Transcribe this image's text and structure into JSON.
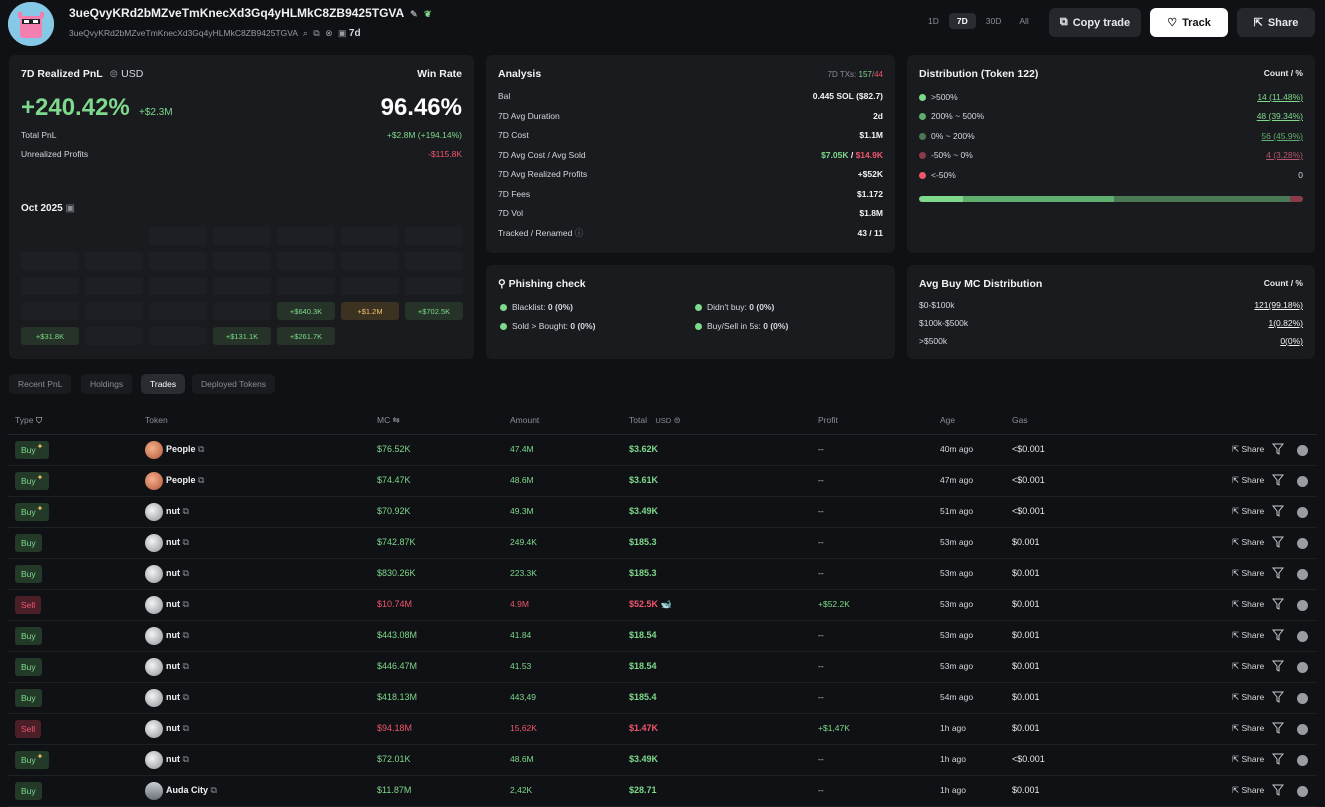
{
  "header": {
    "address": "3ueQvyKRd2bMZveTmKnecXd3Gq4yHLMkC8ZB9425TGVA",
    "address_sub": "3ueQvyKRd2bMZveTmKnecXd3Gq4yHLMkC8ZB9425TGVA",
    "age_label": "7d",
    "periods": [
      "1D",
      "7D",
      "30D",
      "All"
    ],
    "active_period": "7D",
    "copy_trade_label": "Copy trade",
    "track_label": "Track",
    "share_label": "Share"
  },
  "pnl": {
    "title": "7D Realized PnL",
    "currency": "USD",
    "percent": "+240.42%",
    "amount": "+$2.3M",
    "win_rate_label": "Win Rate",
    "win_rate": "96.46%",
    "total_pnl_label": "Total PnL",
    "total_pnl_value": "+$2.8M (+194.14%)",
    "unrealized_label": "Unrealized Profits",
    "unrealized_value": "-$115.8K",
    "calendar_month": "Oct 2025",
    "calendar_values": [
      "+$640.3K",
      "+$1.2M",
      "+$702.5K",
      "+$31.8K",
      "+$131.1K",
      "+$261.7K"
    ]
  },
  "analysis": {
    "title": "Analysis",
    "txs_label": "7D TXs:",
    "txs_buy": "157",
    "txs_sell": "44",
    "rows": [
      {
        "k": "Bal",
        "v": "0.445 SOL ($82.7)"
      },
      {
        "k": "7D Avg Duration",
        "v": "2d"
      },
      {
        "k": "7D Cost",
        "v": "$1.1M"
      },
      {
        "k": "7D Avg Cost / Avg Sold",
        "v": ""
      },
      {
        "k": "7D Avg Realized Profits",
        "v": "+$52K"
      },
      {
        "k": "7D Fees",
        "v": "$1.172"
      },
      {
        "k": "7D Vol",
        "v": "$1.8M"
      },
      {
        "k": "Tracked / Renamed",
        "v": "43 / 11"
      }
    ],
    "avg_cost": "$7.05K",
    "avg_sold": "$14.9K"
  },
  "distribution": {
    "title": "Distribution (Token 122)",
    "header_right": "Count / %",
    "rows": [
      {
        "label": ">500%",
        "value": "14 (11.48%)",
        "color": "#7ed98c"
      },
      {
        "label": "200% ~ 500%",
        "value": "48 (39.34%)",
        "color": "#5fae6e"
      },
      {
        "label": "0% ~ 200%",
        "value": "56 (45.9%)",
        "color": "#4a7a55"
      },
      {
        "label": "-50% ~ 0%",
        "value": "4 (3.28%)",
        "color": "#8a3b4a"
      },
      {
        "label": "<-50%",
        "value": "0",
        "color": "#f0566e"
      }
    ]
  },
  "phishing": {
    "title": "Phishing check",
    "items": [
      {
        "label": "Blacklist:",
        "value": "0 (0%)"
      },
      {
        "label": "Didn't buy:",
        "value": "0 (0%)"
      },
      {
        "label": "Sold > Bought:",
        "value": "0 (0%)"
      },
      {
        "label": "Buy/Sell in 5s:",
        "value": "0 (0%)"
      }
    ]
  },
  "mc_distribution": {
    "title": "Avg Buy MC Distribution",
    "header_right": "Count / %",
    "rows": [
      {
        "label": "$0-$100k",
        "value": "121(99.18%)"
      },
      {
        "label": "$100k-$500k",
        "value": "1(0.82%)"
      },
      {
        "label": ">$500k",
        "value": "0(0%)"
      }
    ]
  },
  "tabs": [
    "Recent PnL",
    "Holdings",
    "Trades",
    "Deployed Tokens"
  ],
  "active_tab": "Trades",
  "table": {
    "headers": {
      "type": "Type",
      "token": "Token",
      "mc": "MC",
      "amount": "Amount",
      "total": "Total",
      "total_unit": "USD",
      "profit": "Profit",
      "age": "Age",
      "gas": "Gas"
    },
    "share_label": "Share",
    "rows": [
      {
        "type": "Buy",
        "spark": true,
        "token": "People",
        "icon": "people",
        "mc": "$76.52K",
        "amount": "47.4M",
        "total": "$3.62K",
        "profit": "--",
        "age": "40m ago",
        "gas": "<$0.001"
      },
      {
        "type": "Buy",
        "spark": true,
        "token": "People",
        "icon": "people",
        "mc": "$74.47K",
        "amount": "48.6M",
        "total": "$3.61K",
        "profit": "--",
        "age": "47m ago",
        "gas": "<$0.001"
      },
      {
        "type": "Buy",
        "spark": true,
        "token": "nut",
        "icon": "nut",
        "mc": "$70.92K",
        "amount": "49.3M",
        "total": "$3.49K",
        "profit": "--",
        "age": "51m ago",
        "gas": "<$0.001"
      },
      {
        "type": "Buy",
        "spark": false,
        "token": "nut",
        "icon": "nut",
        "mc": "$742.87K",
        "amount": "249.4K",
        "total": "$185.3",
        "profit": "--",
        "age": "53m ago",
        "gas": "$0.001"
      },
      {
        "type": "Buy",
        "spark": false,
        "token": "nut",
        "icon": "nut",
        "mc": "$830.26K",
        "amount": "223.3K",
        "total": "$185.3",
        "profit": "--",
        "age": "53m ago",
        "gas": "$0.001"
      },
      {
        "type": "Sell",
        "spark": false,
        "token": "nut",
        "icon": "nut",
        "mc": "$10.74M",
        "amount": "4.9M",
        "total": "$52.5K",
        "whale": true,
        "profit": "+$52.2K",
        "age": "53m ago",
        "gas": "$0.001"
      },
      {
        "type": "Buy",
        "spark": false,
        "token": "nut",
        "icon": "nut",
        "mc": "$443.08M",
        "amount": "41.84",
        "total": "$18.54",
        "profit": "--",
        "age": "53m ago",
        "gas": "$0.001"
      },
      {
        "type": "Buy",
        "spark": false,
        "token": "nut",
        "icon": "nut",
        "mc": "$446.47M",
        "amount": "41.53",
        "total": "$18.54",
        "profit": "--",
        "age": "53m ago",
        "gas": "$0.001"
      },
      {
        "type": "Buy",
        "spark": false,
        "token": "nut",
        "icon": "nut",
        "mc": "$418.13M",
        "amount": "443,49",
        "total": "$185.4",
        "profit": "--",
        "age": "54m ago",
        "gas": "$0.001"
      },
      {
        "type": "Sell",
        "spark": false,
        "token": "nut",
        "icon": "nut",
        "mc": "$94.18M",
        "amount": "15,62K",
        "total": "$1.47K",
        "profit": "+$1,47K",
        "age": "1h ago",
        "gas": "$0.001"
      },
      {
        "type": "Buy",
        "spark": true,
        "token": "nut",
        "icon": "nut",
        "mc": "$72.01K",
        "amount": "48.6M",
        "total": "$3.49K",
        "profit": "--",
        "age": "1h ago",
        "gas": "<$0.001"
      },
      {
        "type": "Buy",
        "spark": false,
        "token": "Auda City",
        "icon": "auda",
        "mc": "$11.87M",
        "amount": "2,42K",
        "total": "$28.71",
        "profit": "--",
        "age": "1h ago",
        "gas": "$0.001"
      }
    ]
  }
}
